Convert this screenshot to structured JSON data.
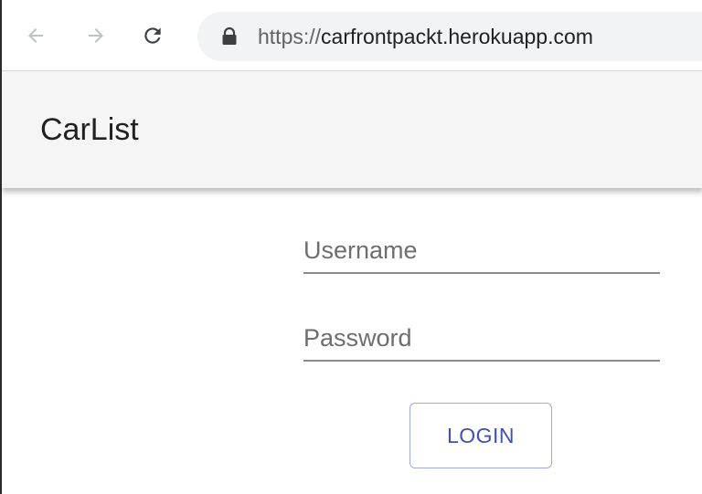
{
  "browser": {
    "url_protocol": "https://",
    "url_host": "carfrontpackt.herokuapp.com"
  },
  "app": {
    "title": "CarList"
  },
  "login": {
    "username_placeholder": "Username",
    "password_placeholder": "Password",
    "button_label": "LOGIN"
  },
  "colors": {
    "app_bar_bg": "#f5f5f5",
    "button_text": "#3f51b5",
    "button_border": "#9fa8da",
    "address_bar_bg": "#f1f3f4"
  },
  "icons": {
    "back": "arrow-left-icon",
    "forward": "arrow-right-icon",
    "reload": "reload-icon",
    "lock": "lock-icon"
  }
}
